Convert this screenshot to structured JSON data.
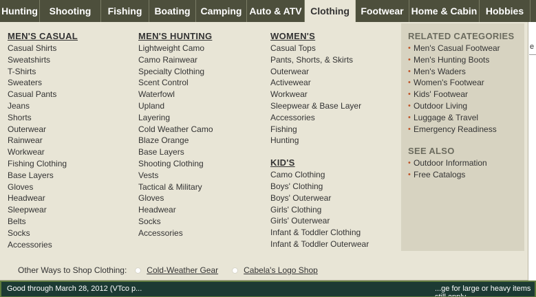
{
  "nav": {
    "tabs": [
      {
        "label": "Hunting",
        "width": 58
      },
      {
        "label": "Shooting",
        "width": 89
      },
      {
        "label": "Fishing",
        "width": 70
      },
      {
        "label": "Boating",
        "width": 68
      },
      {
        "label": "Camping",
        "width": 74
      },
      {
        "label": "Auto & ATV",
        "width": 84
      },
      {
        "label": "Clothing",
        "width": 74,
        "active": true
      },
      {
        "label": "Footwear",
        "width": 78
      },
      {
        "label": "Home & Cabin",
        "width": 102
      },
      {
        "label": "Hobbies",
        "width": 74
      }
    ]
  },
  "columns": {
    "mens_casual": {
      "heading": "MEN'S CASUAL",
      "items": [
        "Casual Shirts",
        "Sweatshirts",
        "T-Shirts",
        "Sweaters",
        "Casual Pants",
        "Jeans",
        "Shorts",
        "Outerwear",
        "Rainwear",
        "Workwear",
        "Fishing Clothing",
        "Base Layers",
        "Gloves",
        "Headwear",
        "Sleepwear",
        "Belts",
        "Socks",
        "Accessories"
      ]
    },
    "mens_hunting": {
      "heading": "MEN'S HUNTING",
      "items": [
        "Lightweight Camo",
        "Camo Rainwear",
        "Specialty Clothing",
        "Scent Control",
        "Waterfowl",
        "Upland",
        "Layering",
        "Cold Weather Camo",
        "Blaze Orange",
        "Base Layers",
        "Shooting Clothing",
        "Vests",
        "Tactical & Military",
        "Gloves",
        "Headwear",
        "Socks",
        "Accessories"
      ]
    },
    "womens": {
      "heading": "WOMEN'S",
      "items": [
        "Casual Tops",
        "Pants, Shorts, & Skirts",
        "Outerwear",
        "Activewear",
        "Workwear",
        "Sleepwear & Base Layer",
        "Accessories",
        "Fishing",
        "Hunting"
      ]
    },
    "kids": {
      "heading": "KID'S",
      "items": [
        "Camo Clothing",
        "Boys' Clothing",
        "Boys' Outerwear",
        "Girls' Clothing",
        "Girls' Outerwear",
        "Infant & Toddler Clothing",
        "Infant & Toddler Outerwear"
      ]
    }
  },
  "related": {
    "heading": "RELATED CATEGORIES",
    "items": [
      "Men's Casual Footwear",
      "Men's Hunting Boots",
      "Men's Waders",
      "Women's Footwear",
      "Kids' Footwear",
      "Outdoor Living",
      "Luggage & Travel",
      "Emergency Readiness"
    ]
  },
  "see_also": {
    "heading": "SEE ALSO",
    "items": [
      "Outdoor Information",
      "Free Catalogs"
    ]
  },
  "other_ways": {
    "label": "Other Ways to Shop Clothing:",
    "links": [
      "Cold-Weather Gear",
      "Cabela's Logo Shop"
    ]
  },
  "promo": {
    "left_text": "Good through March 28, 2012 (VTco p...",
    "right_text": "...ge for large or heavy items still apply"
  },
  "colors": {
    "nav_bg": "#4d4f3c",
    "panel_bg": "#e8e5d6",
    "related_bg": "#d7d3c1",
    "bullet": "#c0562a",
    "promo_bg": "#1c3a33"
  }
}
